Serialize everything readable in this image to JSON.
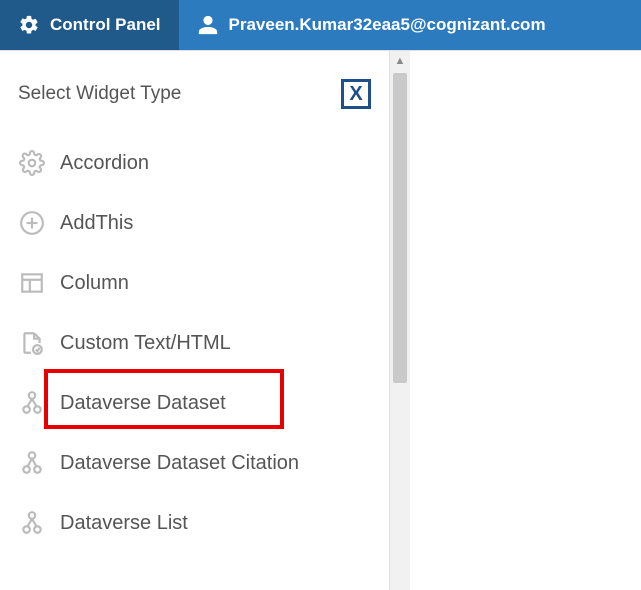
{
  "topbar": {
    "control_panel": "Control Panel",
    "user_email": "Praveen.Kumar32eaa5@cognizant.com"
  },
  "panel": {
    "title": "Select Widget Type",
    "close_label": "X"
  },
  "widgets": {
    "items": [
      {
        "label": "Accordion"
      },
      {
        "label": "AddThis"
      },
      {
        "label": "Column"
      },
      {
        "label": "Custom Text/HTML"
      },
      {
        "label": "Dataverse Dataset"
      },
      {
        "label": "Dataverse Dataset Citation"
      },
      {
        "label": "Dataverse List"
      }
    ]
  }
}
